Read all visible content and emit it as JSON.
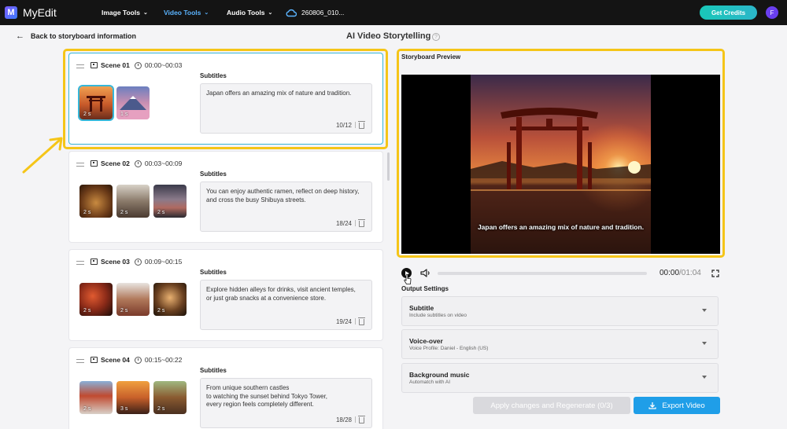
{
  "app": {
    "name": "MyEdit"
  },
  "nav": {
    "items": [
      {
        "label": "Image Tools"
      },
      {
        "label": "Video Tools"
      },
      {
        "label": "Audio Tools"
      }
    ],
    "filename": "260806_010...",
    "get_credits": "Get Credits",
    "avatar_initial": "F"
  },
  "header": {
    "back_label": "Back to storyboard information",
    "title": "AI Video Storytelling"
  },
  "scenes": [
    {
      "name": "Scene 01",
      "time": "00:00~00:03",
      "subtitles_label": "Subtitles",
      "text": "Japan offers an amazing mix of nature and tradition.",
      "count": "10/12",
      "thumbs": [
        "2 s",
        "1 s"
      ]
    },
    {
      "name": "Scene 02",
      "time": "00:03~00:09",
      "subtitles_label": "Subtitles",
      "text": "You can enjoy authentic ramen, reflect on deep history,\nand cross the busy Shibuya streets.",
      "count": "18/24",
      "thumbs": [
        "2 s",
        "2 s",
        "2 s"
      ]
    },
    {
      "name": "Scene 03",
      "time": "00:09~00:15",
      "subtitles_label": "Subtitles",
      "text": "Explore hidden alleys for drinks, visit ancient temples,\nor just grab snacks at a convenience store.",
      "count": "19/24",
      "thumbs": [
        "2 s",
        "2 s",
        "2 s"
      ]
    },
    {
      "name": "Scene 04",
      "time": "00:15~00:22",
      "subtitles_label": "Subtitles",
      "text": "From unique southern castles\nto watching the sunset behind Tokyo Tower,\nevery region feels completely different.",
      "count": "18/28",
      "thumbs": [
        "2 s",
        "3 s",
        "2 s"
      ]
    }
  ],
  "preview": {
    "label": "Storyboard Preview",
    "caption": "Japan offers an amazing mix of nature and tradition.",
    "current_time": "00:00",
    "total_time": "/01:04",
    "progress": 0
  },
  "output": {
    "label": "Output Settings",
    "options": [
      {
        "title": "Subtitle",
        "subtitle": "Include subtitles on video"
      },
      {
        "title": "Voice-over",
        "subtitle": "Voice Profile: Daniel - English (US)"
      },
      {
        "title": "Background music",
        "subtitle": "Automatch with AI"
      }
    ],
    "apply_label": "Apply changes and Regenerate (0/3)",
    "export_label": "Export Video"
  },
  "colors": {
    "highlight": "#f5c518",
    "accent": "#36b6d8",
    "export": "#1f9ee8"
  }
}
